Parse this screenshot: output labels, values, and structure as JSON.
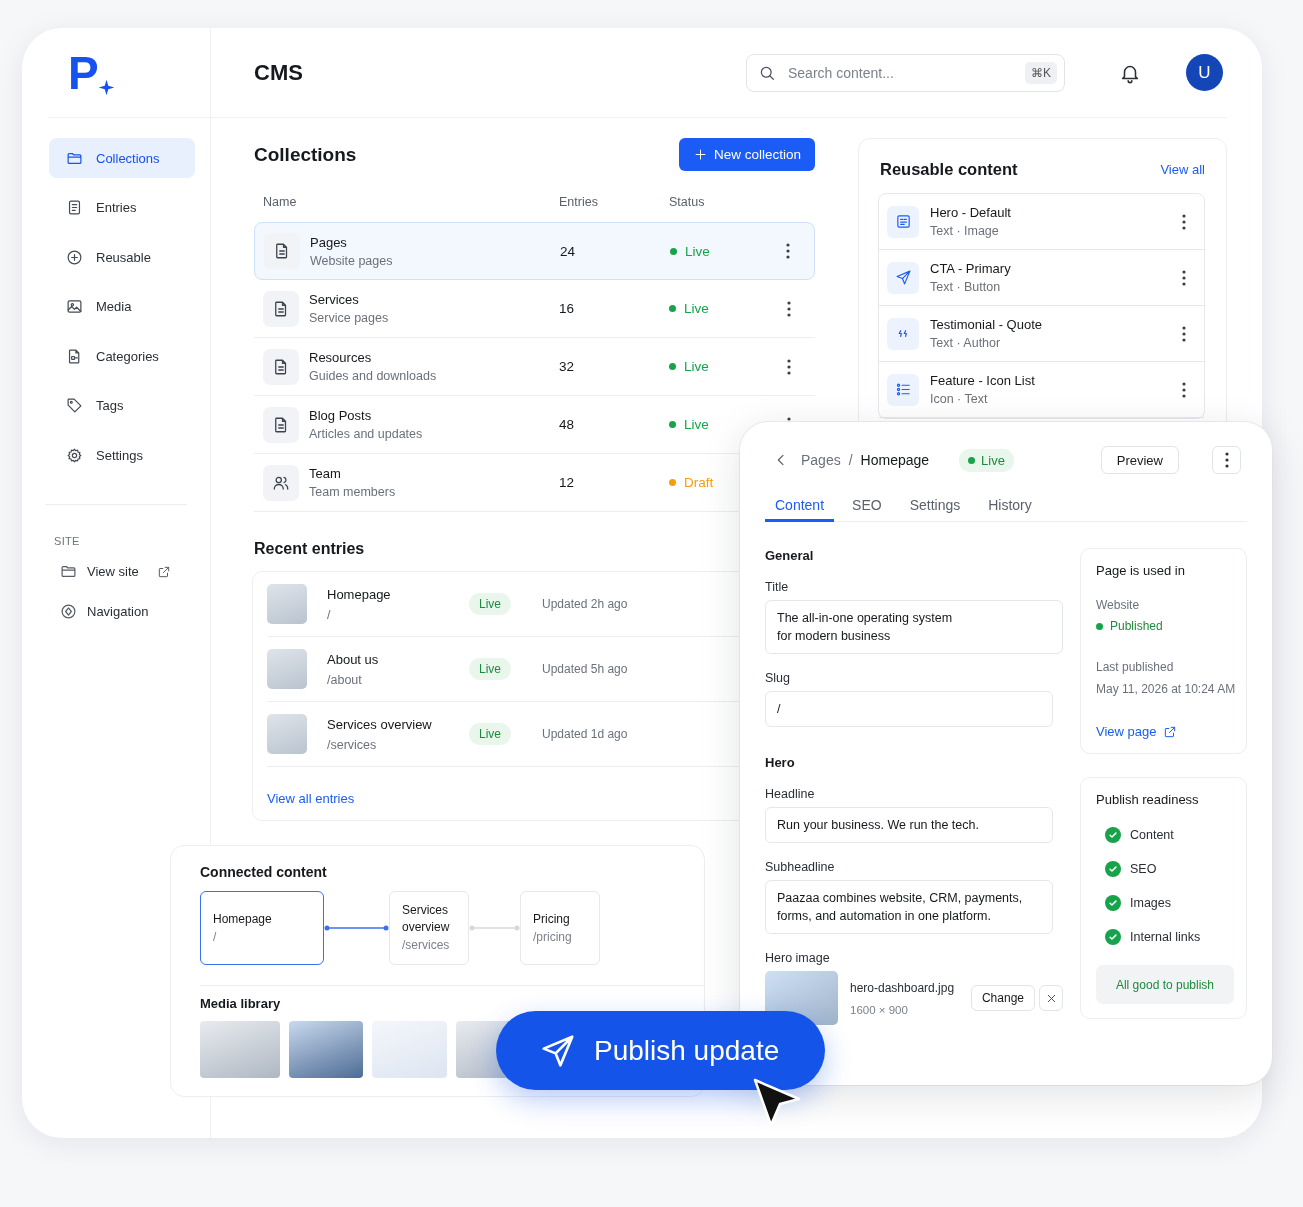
{
  "logo": {
    "text": "P"
  },
  "header": {
    "title": "CMS",
    "search": {
      "placeholder": "Search content...",
      "shortcut": "⌘K"
    },
    "avatar": "U"
  },
  "sidebar": {
    "items": [
      {
        "label": "Collections",
        "selected": true
      },
      {
        "label": "Entries",
        "selected": false
      },
      {
        "label": "Reusable",
        "selected": false
      },
      {
        "label": "Media",
        "selected": false
      },
      {
        "label": "Categories",
        "selected": false
      },
      {
        "label": "Tags",
        "selected": false
      },
      {
        "label": "Settings",
        "selected": false
      }
    ],
    "section_label": "SITE",
    "site_items": [
      {
        "label": "View site",
        "external": true
      },
      {
        "label": "Navigation",
        "external": false
      }
    ]
  },
  "collections": {
    "title": "Collections",
    "new_button": "New collection",
    "columns": [
      "Name",
      "Entries",
      "Status"
    ],
    "rows": [
      {
        "kind": "document",
        "name": "Pages",
        "description": "Website pages",
        "entries": "24",
        "status": "Live",
        "color": "#16a34a",
        "selected": true
      },
      {
        "kind": "document",
        "name": "Services",
        "description": "Service pages",
        "entries": "16",
        "status": "Live",
        "color": "#16a34a",
        "selected": false
      },
      {
        "kind": "document",
        "name": "Resources",
        "description": "Guides and downloads",
        "entries": "32",
        "status": "Live",
        "color": "#16a34a",
        "selected": false
      },
      {
        "kind": "document",
        "name": "Blog Posts",
        "description": "Articles and updates",
        "entries": "48",
        "status": "Live",
        "color": "#16a34a",
        "selected": false
      },
      {
        "kind": "people",
        "name": "Team",
        "description": "Team members",
        "entries": "12",
        "status": "Draft",
        "color": "#f59e0b",
        "selected": false
      }
    ]
  },
  "recent": {
    "title": "Recent entries",
    "entries": [
      {
        "name": "Homepage",
        "path": "/",
        "status": "Live",
        "updated": "Updated 2h ago"
      },
      {
        "name": "About us",
        "path": "/about",
        "status": "Live",
        "updated": "Updated 5h ago"
      },
      {
        "name": "Services overview",
        "path": "/services",
        "status": "Live",
        "updated": "Updated 1d ago"
      }
    ],
    "view_all": "View all entries"
  },
  "reusable": {
    "title": "Reusable content",
    "view_all": "View all",
    "items": [
      {
        "name": "Hero - Default",
        "meta": "Text · Image"
      },
      {
        "name": "CTA - Primary",
        "meta": "Text · Button"
      },
      {
        "name": "Testimonial - Quote",
        "meta": "Text · Author"
      },
      {
        "name": "Feature - Icon List",
        "meta": "Icon · Text"
      }
    ]
  },
  "editor": {
    "breadcrumb": {
      "parent": "Pages",
      "separator": "/",
      "current": "Homepage"
    },
    "status": "Live",
    "preview": "Preview",
    "tabs": [
      {
        "label": "Content",
        "selected": true
      },
      {
        "label": "SEO",
        "selected": false
      },
      {
        "label": "Settings",
        "selected": false
      },
      {
        "label": "History",
        "selected": false
      }
    ],
    "sections": [
      {
        "title": "General",
        "fields": [
          {
            "kind": "text",
            "label": "Title",
            "value": "The all-in-one operating system for modern business"
          },
          {
            "kind": "text",
            "label": "Slug",
            "value": "/"
          }
        ]
      },
      {
        "title": "Hero",
        "fields": [
          {
            "kind": "text",
            "label": "Headline",
            "value": "Run your business. We run the tech."
          },
          {
            "kind": "text",
            "label": "Subheadline",
            "value": "Paazaa combines website, CRM, payments, forms, and automation in one platform."
          },
          {
            "kind": "image",
            "label": "Hero image",
            "file": "hero-dashboard.jpg",
            "dimensions": "1600 × 900",
            "change": "Change"
          }
        ]
      }
    ],
    "usage": {
      "title": "Page is used in",
      "site_label": "Website",
      "site_status": "Published",
      "last_label": "Last published",
      "last_value": "May 11, 2026 at 10:24 AM",
      "link": "View page"
    },
    "readiness": {
      "title": "Publish readiness",
      "checks": [
        {
          "label": "Content",
          "done": true
        },
        {
          "label": "SEO",
          "done": true
        },
        {
          "label": "Images",
          "done": true
        },
        {
          "label": "Internal links",
          "done": true
        }
      ],
      "summary": "All good to publish"
    }
  },
  "connected": {
    "title": "Connected content",
    "nodes": [
      {
        "title": "Homepage",
        "path": "/",
        "selected": true
      },
      {
        "title": "Services overview",
        "path": "/services",
        "selected": false
      },
      {
        "title": "Pricing",
        "path": "/pricing",
        "selected": false
      }
    ],
    "media_title": "Media library"
  },
  "publish": {
    "label": "Publish update"
  }
}
